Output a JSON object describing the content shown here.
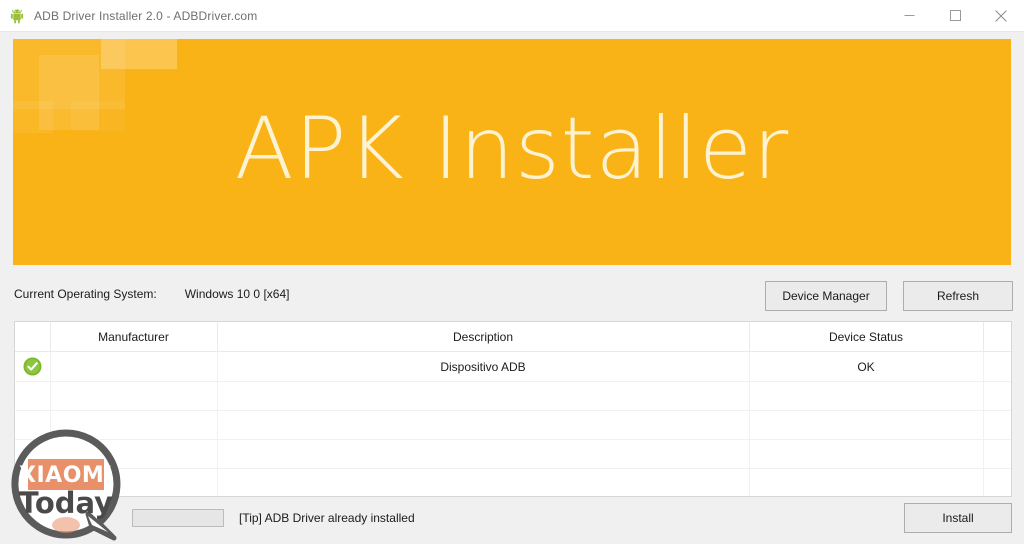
{
  "window": {
    "title": "ADB Driver Installer 2.0 - ADBDriver.com",
    "app_icon": "android-robot-icon",
    "controls": {
      "minimize": "minimize-icon",
      "maximize": "maximize-icon",
      "close": "close-icon"
    }
  },
  "banner": {
    "title": "APK Installer",
    "background_color": "#fab317",
    "text_color": "#fdf3d3"
  },
  "system_info": {
    "label": "Current Operating System:",
    "value": "Windows 10 0 [x64]"
  },
  "toolbar": {
    "device_manager_label": "Device Manager",
    "refresh_label": "Refresh"
  },
  "device_table": {
    "columns": [
      "",
      "Manufacturer",
      "Description",
      "Device Status",
      ""
    ],
    "rows": [
      {
        "status_icon": "green-check-icon",
        "manufacturer": "",
        "description": "Dispositivo ADB",
        "device_status": "OK"
      },
      {
        "status_icon": "",
        "manufacturer": "",
        "description": "",
        "device_status": ""
      },
      {
        "status_icon": "",
        "manufacturer": "",
        "description": "",
        "device_status": ""
      },
      {
        "status_icon": "",
        "manufacturer": "",
        "description": "",
        "device_status": ""
      },
      {
        "status_icon": "",
        "manufacturer": "",
        "description": "",
        "device_status": ""
      }
    ]
  },
  "status_bar": {
    "progress_percent": 0,
    "tip_text": "[Tip] ADB Driver already installed",
    "install_label": "Install"
  },
  "watermark": {
    "top_text": "XIAOMI",
    "bottom_text": "Today",
    "accent_color": "#e8906a"
  }
}
